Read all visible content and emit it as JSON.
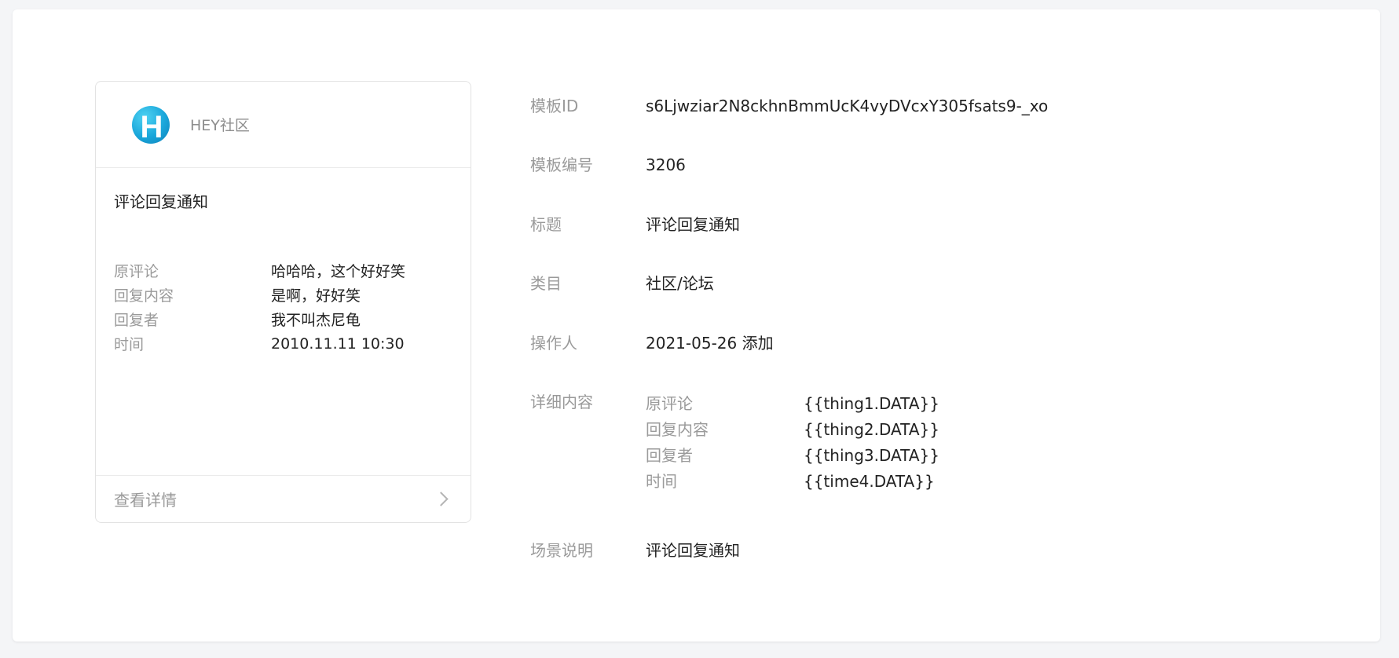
{
  "preview_card": {
    "account_name": "HEY社区",
    "logo_letter": "H",
    "title": "评论回复通知",
    "fields": [
      {
        "label": "原评论",
        "value": "哈哈哈，这个好好笑"
      },
      {
        "label": "回复内容",
        "value": "是啊，好好笑"
      },
      {
        "label": "回复者",
        "value": "我不叫杰尼龟"
      },
      {
        "label": "时间",
        "value": "2010.11.11 10:30"
      }
    ],
    "footer_link": "查看详情"
  },
  "details": {
    "template_id_label": "模板ID",
    "template_id_value": "s6Ljwziar2N8ckhnBmmUcK4vyDVcxY305fsats9-_xo",
    "template_no_label": "模板编号",
    "template_no_value": "3206",
    "title_label": "标题",
    "title_value": "评论回复通知",
    "category_label": "类目",
    "category_value": "社区/论坛",
    "operator_label": "操作人",
    "operator_value": "2021-05-26 添加",
    "content_label": "详细内容",
    "content_items": [
      {
        "key": "原评论",
        "placeholder": "{{thing1.DATA}}"
      },
      {
        "key": "回复内容",
        "placeholder": "{{thing2.DATA}}"
      },
      {
        "key": "回复者",
        "placeholder": "{{thing3.DATA}}"
      },
      {
        "key": "时间",
        "placeholder": "{{time4.DATA}}"
      }
    ],
    "scene_label": "场景说明",
    "scene_value": "评论回复通知"
  },
  "colors": {
    "page_background": "#f4f5f7",
    "panel_background": "#ffffff",
    "label_gray": "#9a9a9a",
    "text_dark": "#222222",
    "logo_blue": "#19a6da"
  }
}
